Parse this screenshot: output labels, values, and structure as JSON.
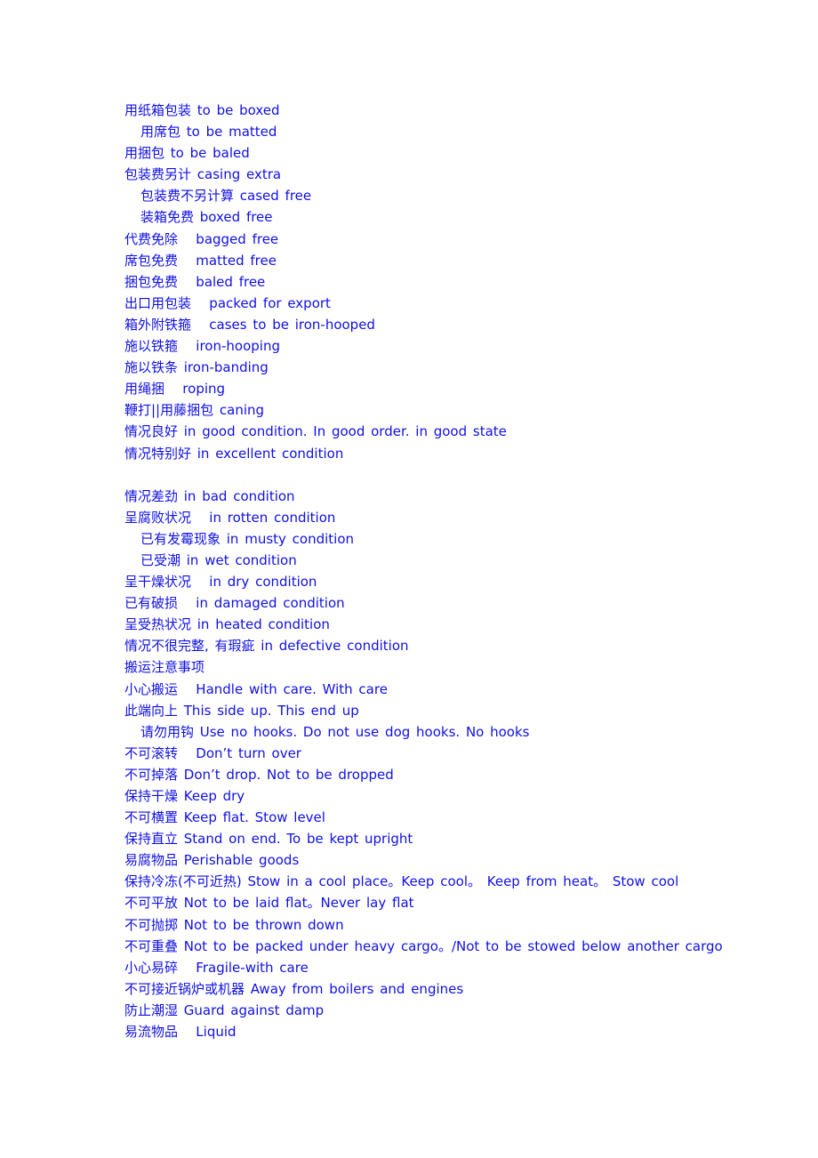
{
  "text_color": "#1010e6",
  "lines": [
    {
      "text": "用纸箱包装 to be boxed",
      "indent": false
    },
    {
      "text": "用席包 to be matted",
      "indent": true
    },
    {
      "text": "用捆包 to be baled",
      "indent": false
    },
    {
      "text": "包装费另计 casing extra",
      "indent": false
    },
    {
      "text": "包装费不另计算 cased free",
      "indent": true
    },
    {
      "text": "装箱免费 boxed free",
      "indent": true
    },
    {
      "text": "代费免除   bagged free",
      "indent": false
    },
    {
      "text": "席包免费   matted free",
      "indent": false
    },
    {
      "text": "捆包免费   baled free",
      "indent": false
    },
    {
      "text": "出口用包装   packed for export",
      "indent": false
    },
    {
      "text": "箱外附铁箍   cases to be iron-hooped",
      "indent": false
    },
    {
      "text": "施以铁箍   iron-hooping",
      "indent": false
    },
    {
      "text": "施以铁条 iron-banding",
      "indent": false
    },
    {
      "text": "用绳捆   roping",
      "indent": false
    },
    {
      "text": "鞭打||用藤捆包 caning",
      "indent": false
    },
    {
      "text": "情况良好 in good condition. In good order. in good state",
      "indent": false
    },
    {
      "text": "情况特别好 in excellent condition",
      "indent": false
    },
    {
      "text": "",
      "indent": false
    },
    {
      "text": "情况差劲 in bad condition",
      "indent": false
    },
    {
      "text": "呈腐败状况   in rotten condition",
      "indent": false
    },
    {
      "text": "已有发霉现象 in musty condition",
      "indent": true
    },
    {
      "text": "已受潮 in wet condition",
      "indent": true
    },
    {
      "text": "呈干燥状况   in dry condition",
      "indent": false
    },
    {
      "text": "已有破损   in damaged condition",
      "indent": false
    },
    {
      "text": "呈受热状况 in heated condition",
      "indent": false
    },
    {
      "text": "情况不很完整, 有瑕疵 in defective condition",
      "indent": false
    },
    {
      "text": "搬运注意事项",
      "indent": false
    },
    {
      "text": "小心搬运   Handle with care. With care",
      "indent": false
    },
    {
      "text": "此端向上 This side up. This end up",
      "indent": false
    },
    {
      "text": "请勿用钩 Use no hooks. Do not use dog hooks. No hooks",
      "indent": true
    },
    {
      "text": "不可滚转   Don’t turn over",
      "indent": false
    },
    {
      "text": "不可掉落 Don’t drop. Not to be dropped",
      "indent": false
    },
    {
      "text": "保持干燥 Keep dry",
      "indent": false
    },
    {
      "text": "不可横置 Keep flat. Stow level",
      "indent": false
    },
    {
      "text": "保持直立 Stand on end. To be kept upright",
      "indent": false
    },
    {
      "text": "易腐物品 Perishable goods",
      "indent": false
    },
    {
      "text": "保持冷冻(不可近热) Stow in a cool place。Keep cool。 Keep from heat。 Stow cool",
      "indent": false
    },
    {
      "text": "不可平放 Not to be laid flat。Never lay flat",
      "indent": false
    },
    {
      "text": "不可抛掷 Not to be thrown down",
      "indent": false
    },
    {
      "text": "不可重叠 Not to be packed under heavy cargo。/Not to be stowed below another cargo",
      "indent": false
    },
    {
      "text": "小心易碎   Fragile-with care",
      "indent": false
    },
    {
      "text": "不可接近锅炉或机器 Away from boilers and engines",
      "indent": false
    },
    {
      "text": "防止潮湿 Guard against damp",
      "indent": false
    },
    {
      "text": "易流物品   Liquid",
      "indent": false
    }
  ]
}
